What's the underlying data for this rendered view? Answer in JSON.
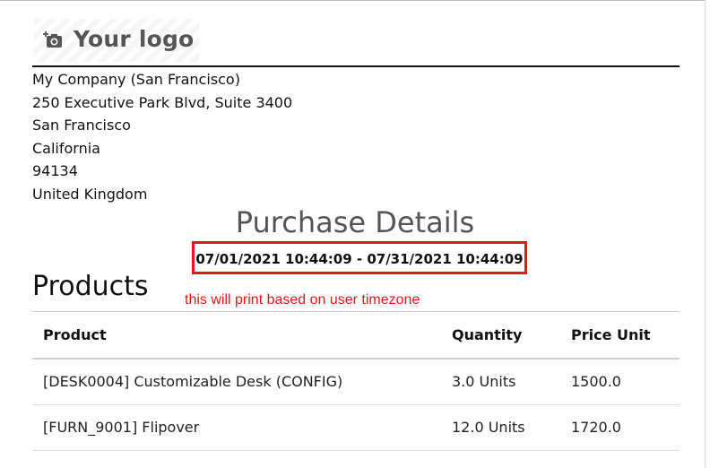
{
  "logo": {
    "icon": "camera-plus-icon",
    "text": "Your logo"
  },
  "company": {
    "lines": [
      "My Company (San Francisco)",
      "250 Executive Park Blvd, Suite 3400",
      "San Francisco",
      "California",
      "94134",
      "United Kingdom"
    ]
  },
  "report": {
    "title": "Purchase Details",
    "date_range": "07/01/2021 10:44:09 - 07/31/2021 10:44:09",
    "annotation": "this will print based on user timezone",
    "highlight_color": "#e8151b"
  },
  "products": {
    "section_title": "Products",
    "columns": [
      "Product",
      "Quantity",
      "Price Unit"
    ],
    "rows": [
      {
        "product": "[DESK0004] Customizable Desk (CONFIG)",
        "quantity": "3.0 Units",
        "price_unit": "1500.0"
      },
      {
        "product": "[FURN_9001] Flipover",
        "quantity": "12.0 Units",
        "price_unit": "1720.0"
      }
    ]
  }
}
